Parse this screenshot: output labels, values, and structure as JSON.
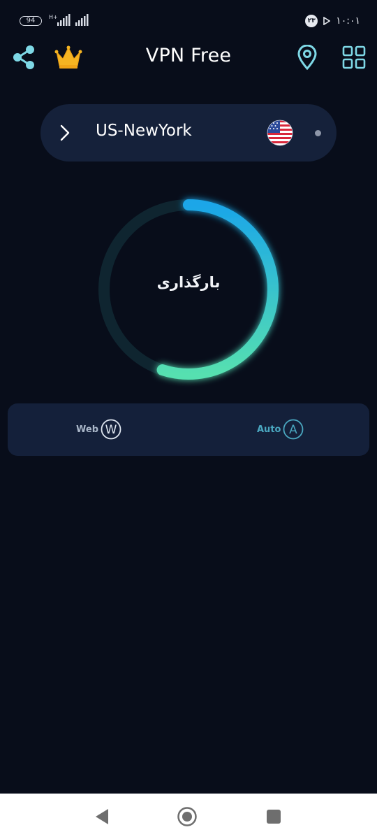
{
  "status_bar": {
    "battery": "94",
    "network": "H+",
    "time": "۱۰:۰۱",
    "badge": "۲۳"
  },
  "header": {
    "title": "VPN Free"
  },
  "server": {
    "name": "US-NewYork"
  },
  "connection": {
    "status_text": "بارگذاری",
    "progress": 0.55
  },
  "modes": {
    "web_label": "Web",
    "web_letter": "W",
    "auto_label": "Auto",
    "auto_letter": "A"
  },
  "colors": {
    "background": "#080d1a",
    "panel": "#15213a",
    "accent_cyan": "#7ed8e6",
    "ring_start": "#1ba6e8",
    "ring_end": "#56e0b0",
    "crown": "#f5b422"
  },
  "icons": {
    "share": "share-icon",
    "crown": "crown-icon",
    "location": "location-pin-icon",
    "grid": "grid-icon",
    "chevron": "chevron-right-icon",
    "flag": "us-flag-icon",
    "back": "back-icon",
    "home": "home-icon",
    "recent": "recent-apps-icon"
  }
}
